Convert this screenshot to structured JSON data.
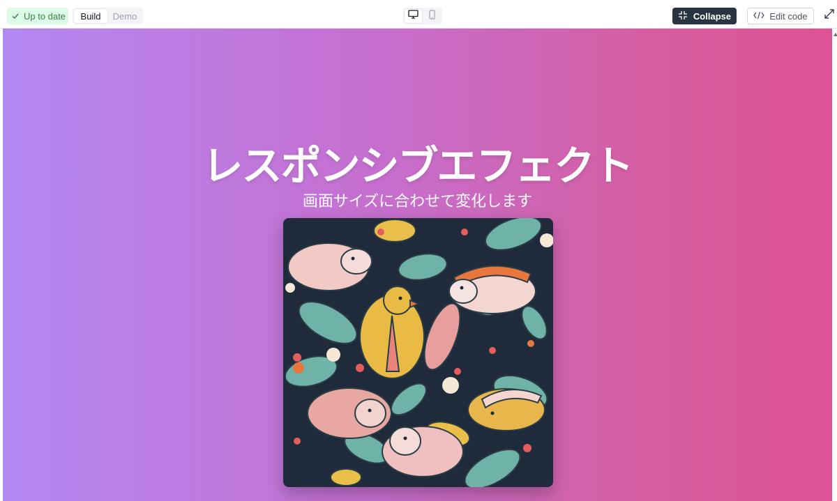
{
  "toolbar": {
    "status_label": "Up to date",
    "build_label": "Build",
    "demo_label": "Demo",
    "collapse_label": "Collapse",
    "edit_code_label": "Edit code",
    "active_view": "desktop",
    "icons": [
      "check-icon",
      "desktop-icon",
      "mobile-icon",
      "collapse-icon",
      "code-icon",
      "expand-icon"
    ]
  },
  "preview": {
    "title": "レスポンシブエフェクト",
    "subtitle": "画面サイズに合わせて変化します",
    "gradient": [
      "#b488f3",
      "#de5395"
    ]
  },
  "colors": {
    "status_bg": "#dcfce7",
    "status_text": "#3f7f4e",
    "collapse_bg": "#2a3340",
    "image_bg": "#1f2a3a"
  }
}
